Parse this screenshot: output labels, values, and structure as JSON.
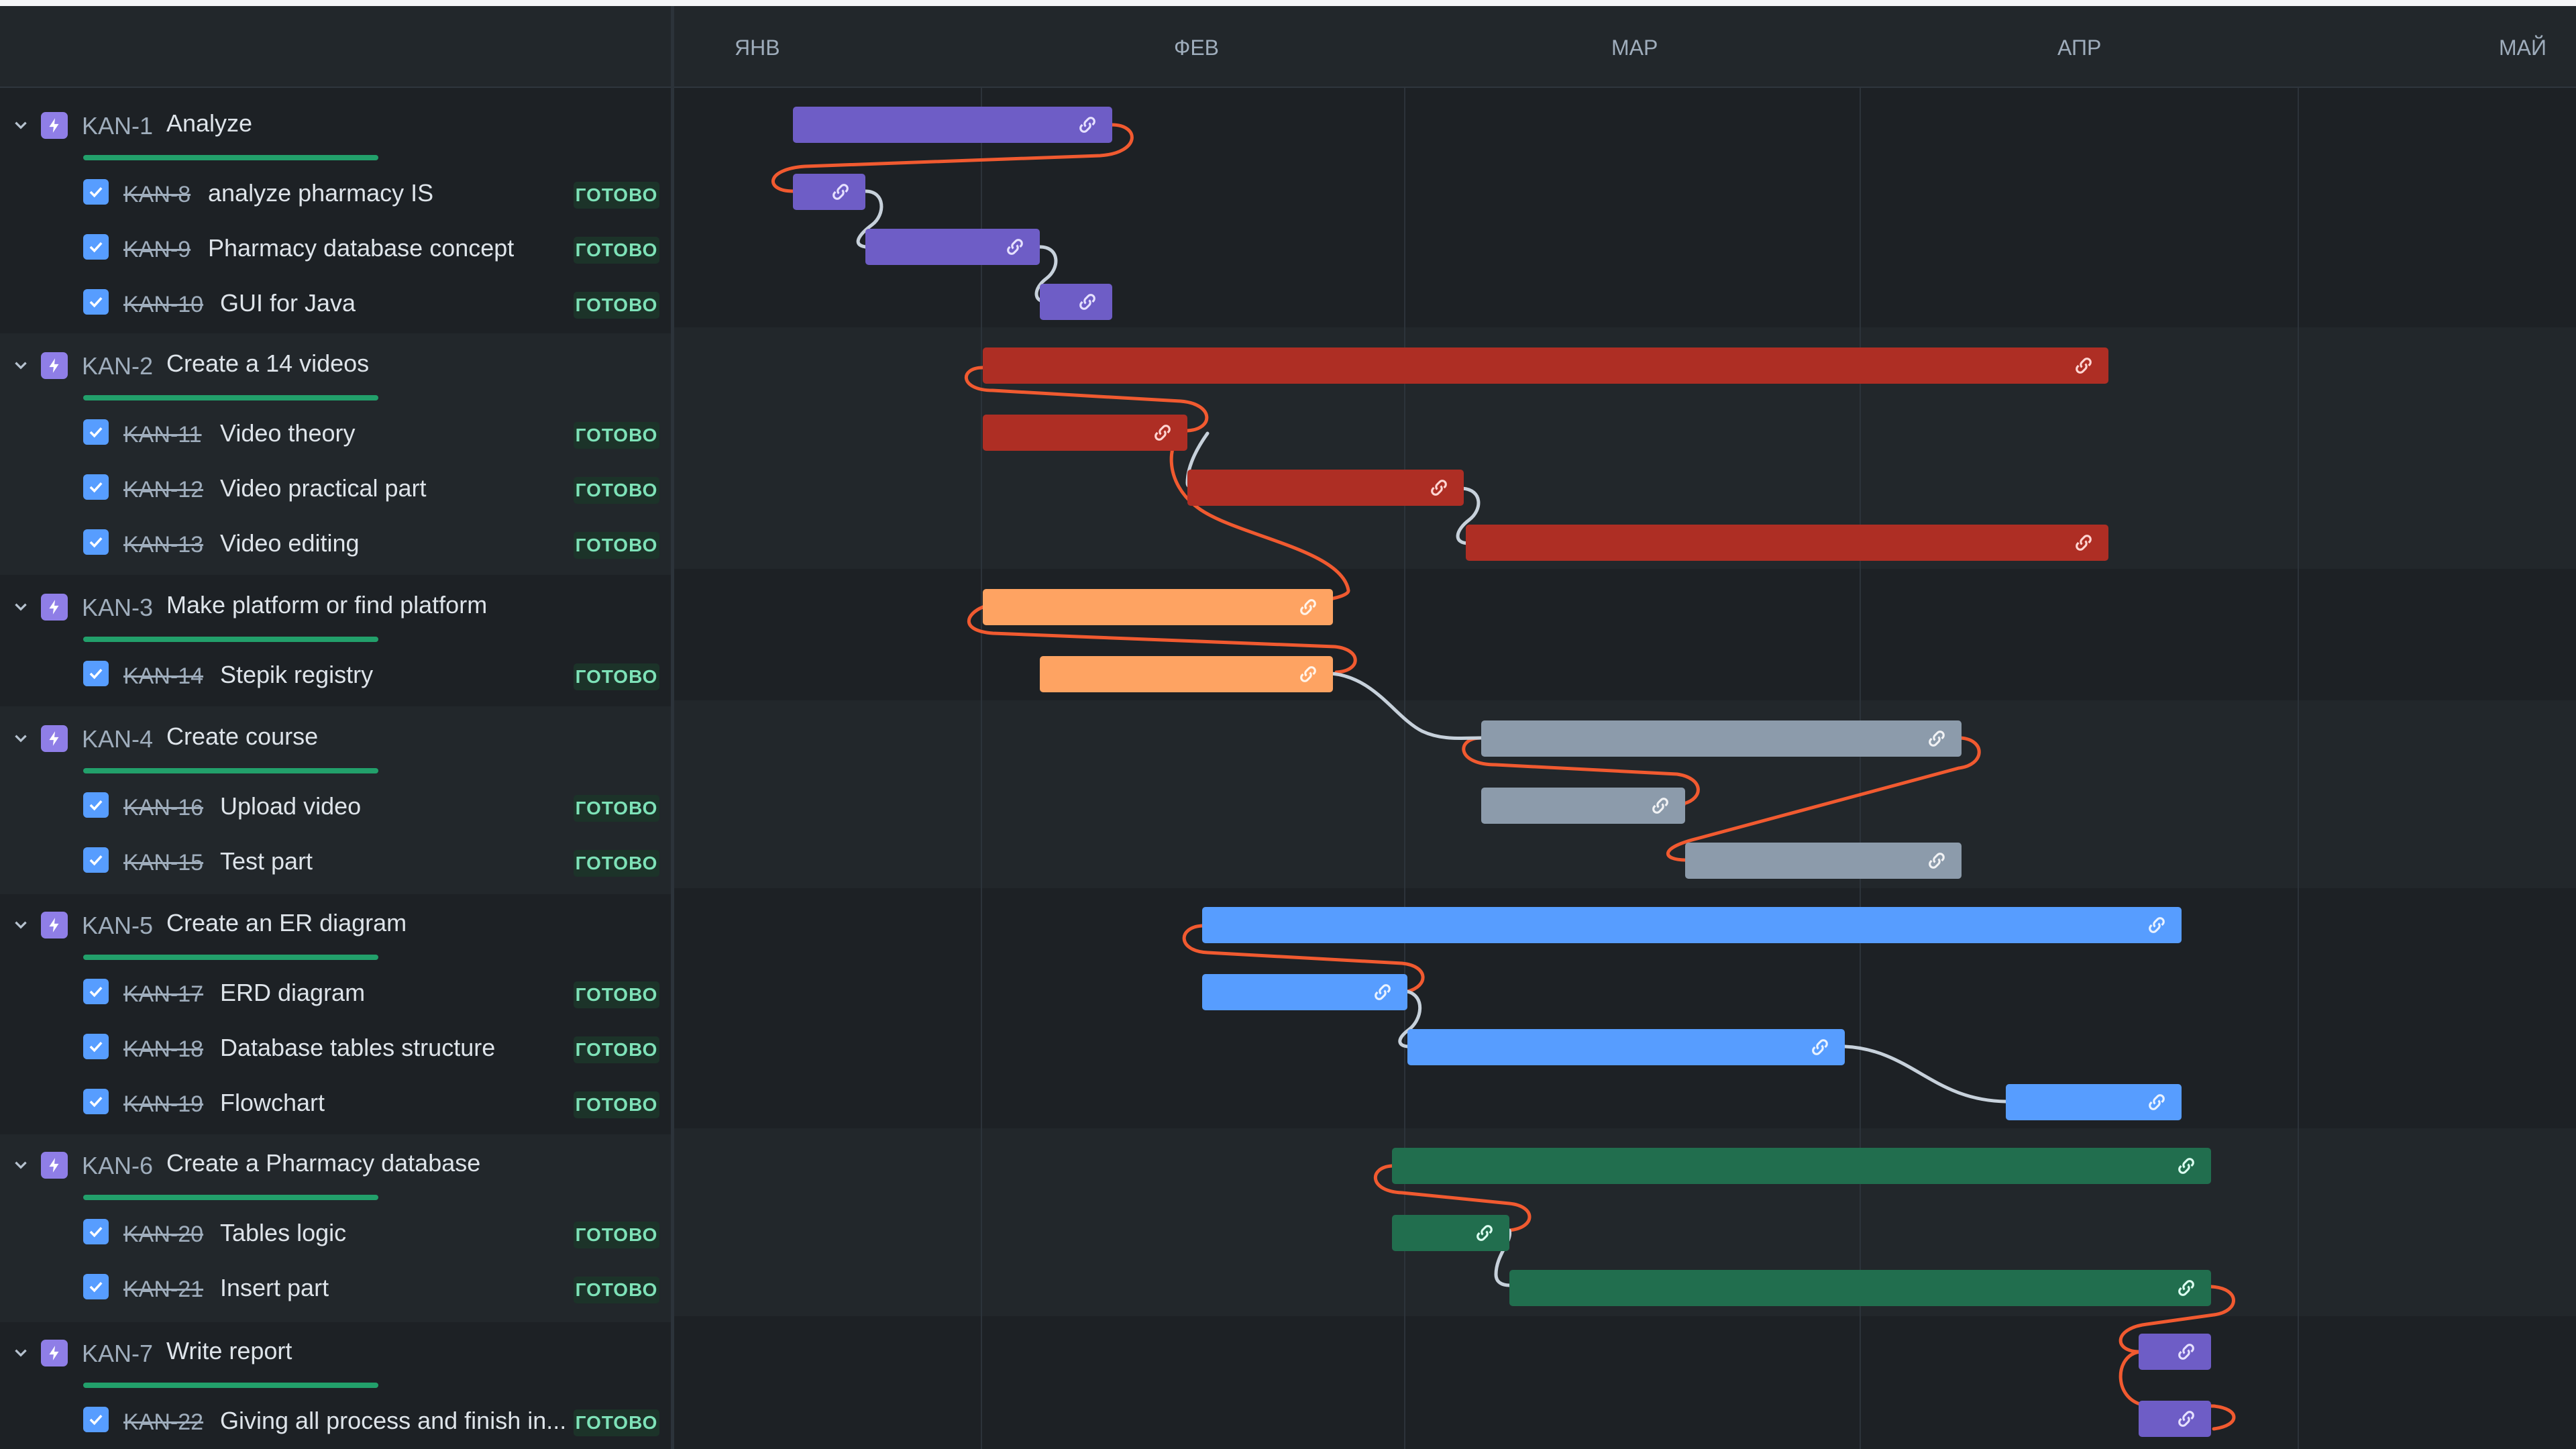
{
  "colors": {
    "background": "#1d2125",
    "header": "#22272b",
    "status_bg": "#1c3329",
    "status_text": "#7ee2b8",
    "progress": "#22a06b",
    "dependency_critical": "#f15a30",
    "dependency_normal": "#c7d1db",
    "epic_purple": "#6e5dc6",
    "red": "#ae2e24",
    "orange": "#fea362",
    "gray": "#8c9bab",
    "blue": "#579dff",
    "green": "#216e4e"
  },
  "timeline": {
    "months": [
      "ЯНВ",
      "ФЕВ",
      "МАР",
      "АПР",
      "МАЙ"
    ]
  },
  "status_label": "ГОТОВО",
  "epics": [
    {
      "key": "KAN-1",
      "title": "Analyze",
      "color": "#6e5dc6",
      "tasks": [
        {
          "key": "KAN-8",
          "title": "analyze pharmacy IS",
          "status": "ГОТОВО"
        },
        {
          "key": "KAN-9",
          "title": "Pharmacy database concept",
          "status": "ГОТОВО"
        },
        {
          "key": "KAN-10",
          "title": "GUI for Java",
          "status": "ГОТОВО"
        }
      ]
    },
    {
      "key": "KAN-2",
      "title": "Create a 14 videos",
      "color": "#ae2e24",
      "tasks": [
        {
          "key": "KAN-11",
          "title": "Video theory",
          "status": "ГОТОВО"
        },
        {
          "key": "KAN-12",
          "title": "Video practical part",
          "status": "ГОТОВО"
        },
        {
          "key": "KAN-13",
          "title": "Video editing",
          "status": "ГОТОВО"
        }
      ]
    },
    {
      "key": "KAN-3",
      "title": "Make platform or find platform",
      "color": "#fea362",
      "tasks": [
        {
          "key": "KAN-14",
          "title": "Stepik registry",
          "status": "ГОТОВО"
        }
      ]
    },
    {
      "key": "KAN-4",
      "title": "Create course",
      "color": "#8c9bab",
      "tasks": [
        {
          "key": "KAN-16",
          "title": "Upload video",
          "status": "ГОТОВО"
        },
        {
          "key": "KAN-15",
          "title": "Test part",
          "status": "ГОТОВО"
        }
      ]
    },
    {
      "key": "KAN-5",
      "title": "Create an ER diagram",
      "color": "#579dff",
      "tasks": [
        {
          "key": "KAN-17",
          "title": "ERD diagram",
          "status": "ГОТОВО"
        },
        {
          "key": "KAN-18",
          "title": "Database tables structure",
          "status": "ГОТОВО"
        },
        {
          "key": "KAN-19",
          "title": "Flowchart",
          "status": "ГОТОВО"
        }
      ]
    },
    {
      "key": "KAN-6",
      "title": "Create a Pharmacy database",
      "color": "#216e4e",
      "tasks": [
        {
          "key": "KAN-20",
          "title": "Tables logic",
          "status": "ГОТОВО"
        },
        {
          "key": "KAN-21",
          "title": "Insert part",
          "status": "ГОТОВО"
        }
      ]
    },
    {
      "key": "KAN-7",
      "title": "Write report",
      "color": "#6e5dc6",
      "tasks": [
        {
          "key": "KAN-22",
          "title": "Giving all process and finish in...",
          "status": "ГОТОВО"
        }
      ]
    }
  ]
}
